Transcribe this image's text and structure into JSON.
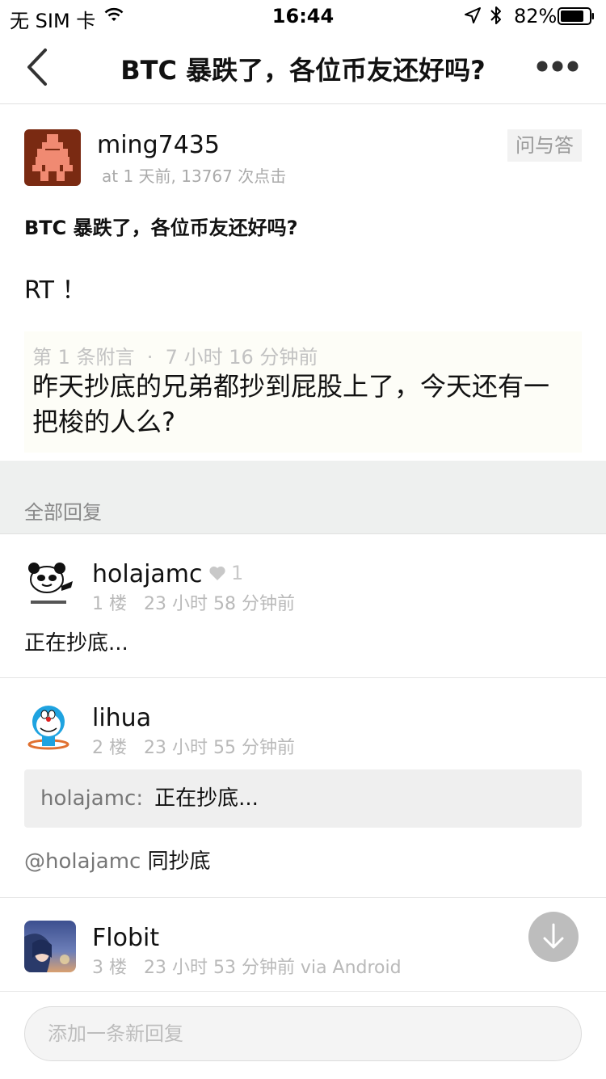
{
  "status_bar": {
    "carrier": "无 SIM 卡",
    "time": "16:44",
    "battery": "82%"
  },
  "nav": {
    "title": "BTC 暴跌了，各位币友还好吗?",
    "icons": [
      "chevron-left-icon",
      "more-dots-icon"
    ]
  },
  "post": {
    "author": "ming7435",
    "meta": "at 1 天前, 13767 次点击",
    "node": "问与答",
    "title": "BTC 暴跌了，各位币友还好吗?",
    "body": "RT ！",
    "append_header": "第 1 条附言  ·  7 小时 16 分钟前",
    "append_text": "昨天抄底的兄弟都抄到屁股上了，今天还有一把梭的人么?"
  },
  "replies_label": "全部回复",
  "replies": [
    {
      "user": "holajamc",
      "likes": "1",
      "meta": "1 楼   23 小时 58 分钟前",
      "content": "正在抄底..."
    },
    {
      "user": "lihua",
      "meta": "2 楼   23 小时 55 分钟前",
      "quote_user": "holajamc:",
      "quote_text": "正在抄底...",
      "mention": "@holajamc",
      "content": " 同抄底"
    },
    {
      "user": "Flobit",
      "meta": "3 楼   23 小时 53 分钟前 via Android"
    }
  ],
  "reply_input": {
    "placeholder": "添加一条新回复"
  },
  "colors": {
    "background": "#ffffff",
    "separator_band": "#eef0ef",
    "append_bg": "#fdfdf7",
    "meta_text": "#aaaaaa",
    "fab": "#bdbdbd"
  }
}
